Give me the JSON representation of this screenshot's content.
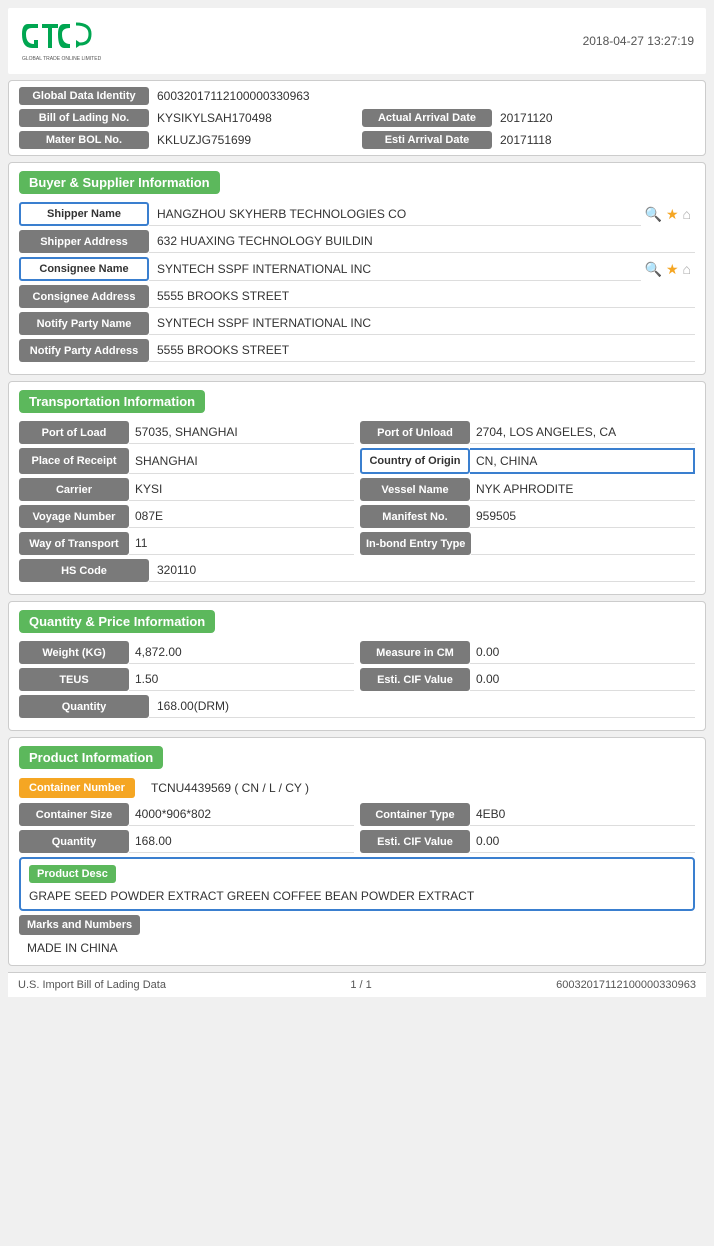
{
  "header": {
    "datetime": "2018-04-27 13:27:19",
    "logo_alt": "GTC Global Trade Online Limited"
  },
  "identity": {
    "global_data_label": "Global Data Identity",
    "global_data_value": "60032017112100000330963",
    "bol_label": "Bill of Lading No.",
    "bol_value": "KYSIKYLSAH170498",
    "actual_arrival_label": "Actual Arrival Date",
    "actual_arrival_value": "20171120",
    "master_bol_label": "Mater BOL No.",
    "master_bol_value": "KKLUZJG751699",
    "esti_arrival_label": "Esti Arrival Date",
    "esti_arrival_value": "20171118"
  },
  "buyer_supplier": {
    "section_title": "Buyer & Supplier Information",
    "shipper_name_label": "Shipper Name",
    "shipper_name_value": "HANGZHOU SKYHERB TECHNOLOGIES CO",
    "shipper_address_label": "Shipper Address",
    "shipper_address_value": "632 HUAXING TECHNOLOGY BUILDIN",
    "consignee_name_label": "Consignee Name",
    "consignee_name_value": "SYNTECH SSPF INTERNATIONAL INC",
    "consignee_address_label": "Consignee Address",
    "consignee_address_value": "5555 BROOKS STREET",
    "notify_party_name_label": "Notify Party Name",
    "notify_party_name_value": "SYNTECH SSPF INTERNATIONAL INC",
    "notify_party_address_label": "Notify Party Address",
    "notify_party_address_value": "5555 BROOKS STREET"
  },
  "transportation": {
    "section_title": "Transportation Information",
    "port_of_load_label": "Port of Load",
    "port_of_load_value": "57035, SHANGHAI",
    "port_of_unload_label": "Port of Unload",
    "port_of_unload_value": "2704, LOS ANGELES, CA",
    "place_of_receipt_label": "Place of Receipt",
    "place_of_receipt_value": "SHANGHAI",
    "country_of_origin_label": "Country of Origin",
    "country_of_origin_value": "CN, CHINA",
    "carrier_label": "Carrier",
    "carrier_value": "KYSI",
    "vessel_name_label": "Vessel Name",
    "vessel_name_value": "NYK APHRODITE",
    "voyage_number_label": "Voyage Number",
    "voyage_number_value": "087E",
    "manifest_no_label": "Manifest No.",
    "manifest_no_value": "959505",
    "way_of_transport_label": "Way of Transport",
    "way_of_transport_value": "11",
    "in_bond_label": "In-bond Entry Type",
    "in_bond_value": "",
    "hs_code_label": "HS Code",
    "hs_code_value": "320110"
  },
  "quantity_price": {
    "section_title": "Quantity & Price Information",
    "weight_label": "Weight (KG)",
    "weight_value": "4,872.00",
    "measure_label": "Measure in CM",
    "measure_value": "0.00",
    "teus_label": "TEUS",
    "teus_value": "1.50",
    "esti_cif_label": "Esti. CIF Value",
    "esti_cif_value": "0.00",
    "quantity_label": "Quantity",
    "quantity_value": "168.00(DRM)"
  },
  "product": {
    "section_title": "Product Information",
    "container_number_label": "Container Number",
    "container_number_value": "TCNU4439569 ( CN / L / CY )",
    "container_size_label": "Container Size",
    "container_size_value": "4000*906*802",
    "container_type_label": "Container Type",
    "container_type_value": "4EB0",
    "quantity_label": "Quantity",
    "quantity_value": "168.00",
    "esti_cif_label": "Esti. CIF Value",
    "esti_cif_value": "0.00",
    "product_desc_label": "Product Desc",
    "product_desc_value": "GRAPE SEED POWDER EXTRACT GREEN COFFEE BEAN POWDER EXTRACT",
    "marks_label": "Marks and Numbers",
    "marks_value": "MADE IN CHINA"
  },
  "footer": {
    "left": "U.S. Import Bill of Lading Data",
    "center": "1 / 1",
    "right": "60032017112100000330963"
  },
  "icons": {
    "search": "🔍",
    "star": "★",
    "home": "⌂"
  }
}
